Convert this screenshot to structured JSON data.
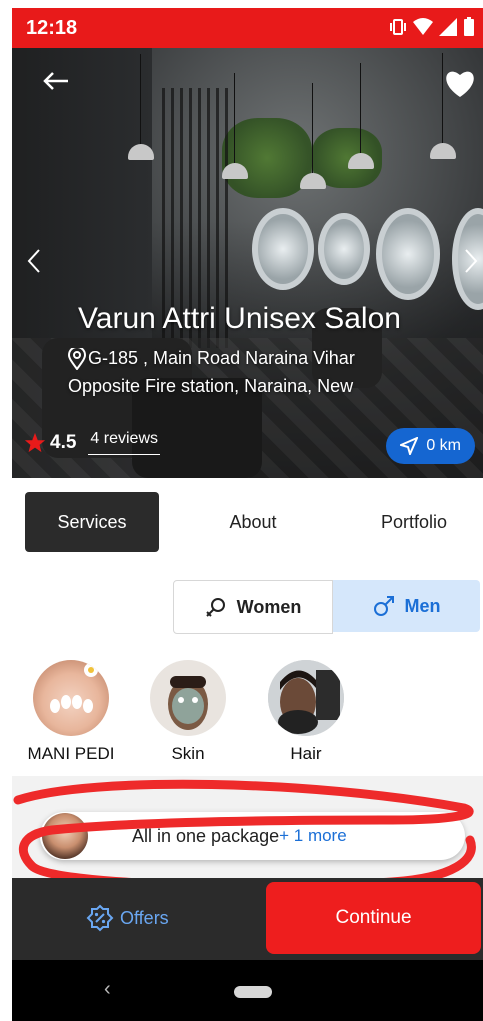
{
  "status_bar": {
    "time": "12:18"
  },
  "hero": {
    "salon_name": "Varun Attri Unisex Salon",
    "address_line1": "G-185 , Main Road Naraina Vihar",
    "address_line2": "Opposite Fire station, Naraina, New",
    "rating": "4.5",
    "reviews": "4 reviews",
    "distance": "0 km"
  },
  "tabs": [
    {
      "label": "Services",
      "active": true
    },
    {
      "label": "About",
      "active": false
    },
    {
      "label": "Portfolio",
      "active": false
    }
  ],
  "gender_filter": {
    "women_label": "Women",
    "men_label": "Men",
    "selected": "Men"
  },
  "categories": [
    {
      "label": "MANI PEDI",
      "icon": "nails-photo"
    },
    {
      "label": "Skin",
      "icon": "face-mask-photo"
    },
    {
      "label": "Hair",
      "icon": "haircut-photo"
    }
  ],
  "package": {
    "label": "All in one package",
    "more": "+ 1 more"
  },
  "bottom_bar": {
    "offers_label": "Offers",
    "continue_label": "Continue"
  },
  "colors": {
    "accent": "#e81a1a",
    "primary_blue": "#1b6fd6",
    "dark": "#2b2b2b"
  }
}
